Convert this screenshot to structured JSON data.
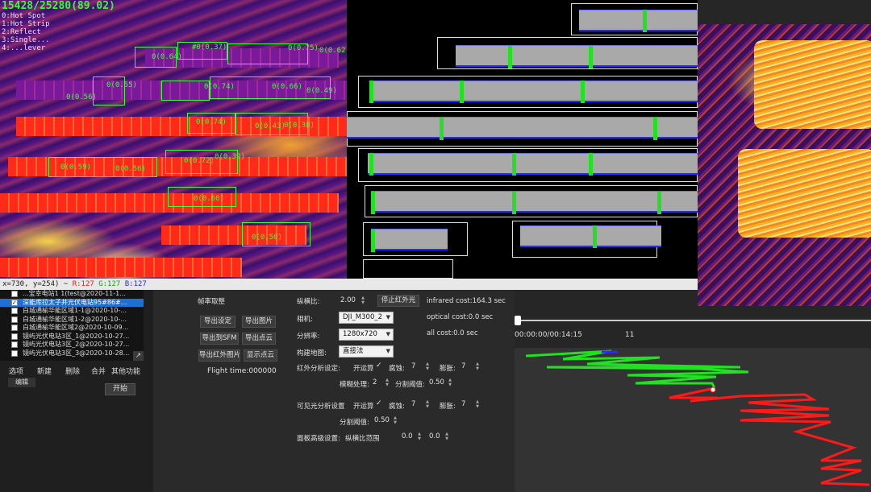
{
  "thermal": {
    "title": "15428/25280(89.02)",
    "legend": [
      "0:Hot Spot",
      "1:Hot Strip",
      "2:Reflect",
      "3:Single...",
      "4:...lever"
    ],
    "labels": [
      "0(0.64)",
      "#0(0.37)",
      "0(0.75)",
      "0(0.62)",
      "0(0.55)",
      "0(0.56)",
      "0(0.74)",
      "0(0.66)",
      "0(0.49)",
      "0(0.74)",
      "0(0.43)",
      "0(0.38)",
      "0(0.59)",
      "0(0.56)",
      "0(0.72)",
      "0(0.39)",
      "0(0.60)",
      "0(0.50)"
    ]
  },
  "status_bar": {
    "coords": "x=730, y=254) ~ ",
    "r": "R:127",
    "g": "G:127",
    "b": "B:127"
  },
  "file_list": {
    "items": [
      {
        "label": "...宝幸电站1 1(test@2020-11-1...",
        "selected": false,
        "checked": false
      },
      {
        "label": "深能库拉太子井光伏电站95#86#...",
        "selected": true,
        "checked": true
      },
      {
        "label": "白城通榆华能区域1-1@2020-10-...",
        "selected": false,
        "checked": false
      },
      {
        "label": "白城通榆华能区域1-2@2020-10-...",
        "selected": false,
        "checked": false
      },
      {
        "label": "白城通榆华能区域2@2020-10-09...",
        "selected": false,
        "checked": false
      },
      {
        "label": "镜屿光伏电站3区_1@2020-10-27...",
        "selected": false,
        "checked": false
      },
      {
        "label": "镜屿光伏电站3区_2@2020-10-27...",
        "selected": false,
        "checked": false
      },
      {
        "label": "镜屿光伏电站3区_3@2020-10-28...",
        "selected": false,
        "checked": false
      }
    ],
    "buttons": [
      "选项",
      "新建",
      "删除",
      "合并",
      "其他功能"
    ],
    "edit_tab": "编辑",
    "start": "开始"
  },
  "controls": {
    "frame_skip": "帧率取整",
    "export_settings": "导出设定",
    "export_images": "导出图片",
    "export_sfm": "导出到SFM",
    "export_points": "导出点云",
    "export_ir_images": "导出红外图片",
    "show_points": "显示点云",
    "flight_time": "Flight time:000000",
    "aspect_label": "纵横比:",
    "aspect_value": "2.00",
    "stop_ir": "停止红外光",
    "camera_label": "相机:",
    "camera_value": "DJI_M300_2",
    "resolution_label": "分辨率:",
    "resolution_value": "1280x720",
    "map_label": "构建地图:",
    "map_value": "直接法",
    "infrared_cost": "infrared cost:164.3 sec",
    "optical_cost": "optical cost:0.0 sec",
    "all_cost": "all cost:0.0 sec",
    "ir_settings_label": "红外分析设定:",
    "ir_open": "开运算",
    "ir_erode_label": "腐蚀:",
    "ir_erode_value": "7",
    "ir_dilate_label": "膨胀:",
    "ir_dilate_value": "7",
    "ir_blur_label": "模糊处理:",
    "ir_blur_value": "2",
    "ir_thresh_label": "分割阈值:",
    "ir_thresh_value": "0.50",
    "vis_settings_label": "可见光分析设置",
    "vis_open": "开运算",
    "vis_erode_label": "腐蚀:",
    "vis_erode_value": "7",
    "vis_dilate_label": "膨胀:",
    "vis_dilate_value": "7",
    "vis_thresh_label": "分割阈值:",
    "vis_thresh_value": "0.50",
    "panel_adv_label": "面板高级设置:",
    "aspect_range_label": "纵横比范围",
    "aspect_range_min": "0.0",
    "aspect_range_max": "0.0",
    "checkmark": "✓"
  },
  "video": {
    "time": "00:00:00/00:14:15",
    "frame": "11",
    "progress": 0.0
  },
  "colors": {
    "path_done": "#22e022",
    "path_todo": "#ff1a1a",
    "path_current": "#2a2aff",
    "detection": "#3cff3c"
  }
}
